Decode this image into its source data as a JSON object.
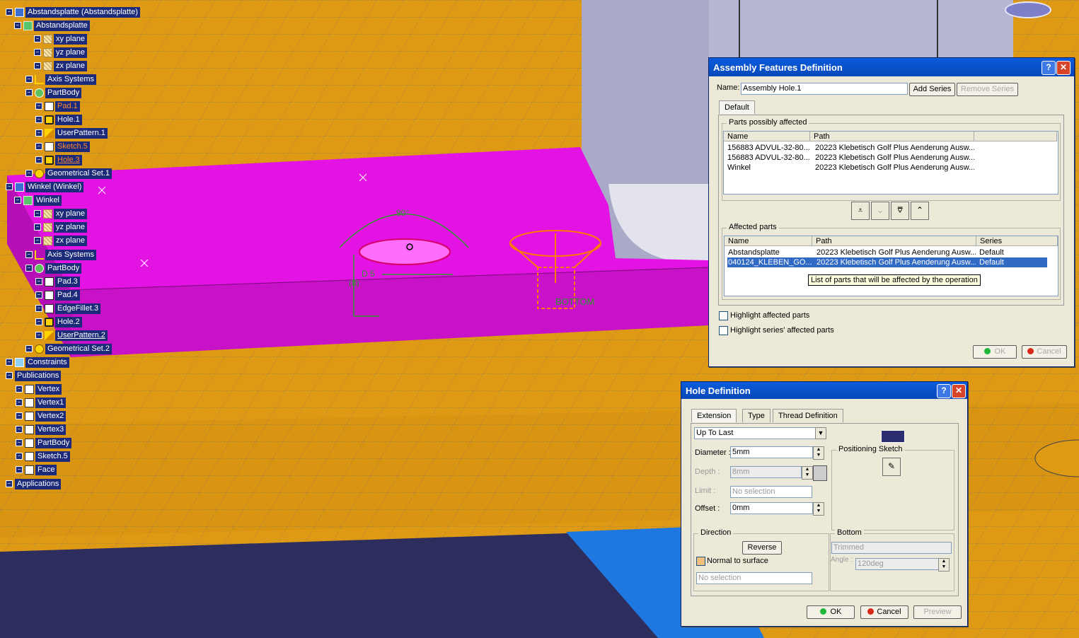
{
  "tree": {
    "items": [
      {
        "label": "Abstandsplatte (Abstandsplatte)",
        "icon": "product-icon",
        "x": 8,
        "y": 9,
        "style": ""
      },
      {
        "label": "Abstandsplatte",
        "icon": "part-icon",
        "x": 20,
        "y": 28,
        "style": ""
      },
      {
        "label": "xy plane",
        "icon": "plane-icon",
        "x": 48,
        "y": 47,
        "style": ""
      },
      {
        "label": "yz plane",
        "icon": "plane-icon",
        "x": 48,
        "y": 66,
        "style": ""
      },
      {
        "label": "zx plane",
        "icon": "plane-icon",
        "x": 48,
        "y": 85,
        "style": ""
      },
      {
        "label": "Axis Systems",
        "icon": "axis-icon",
        "x": 36,
        "y": 104,
        "style": ""
      },
      {
        "label": "PartBody",
        "icon": "body-icon",
        "x": 36,
        "y": 123,
        "style": ""
      },
      {
        "label": "Pad.1",
        "icon": "pad-icon",
        "x": 50,
        "y": 142,
        "style": "orange"
      },
      {
        "label": "Hole.1",
        "icon": "hole-icon",
        "x": 50,
        "y": 161,
        "style": ""
      },
      {
        "label": "UserPattern.1",
        "icon": "pattern-icon",
        "x": 50,
        "y": 180,
        "style": ""
      },
      {
        "label": "Sketch.5",
        "icon": "sketch-icon",
        "x": 50,
        "y": 199,
        "style": "orange"
      },
      {
        "label": "Hole.3",
        "icon": "hole-icon",
        "x": 50,
        "y": 218,
        "style": "hl"
      },
      {
        "label": "Geometrical Set.1",
        "icon": "geoset-icon",
        "x": 36,
        "y": 237,
        "style": ""
      },
      {
        "label": "Winkel (Winkel)",
        "icon": "product-icon",
        "x": 8,
        "y": 256,
        "style": ""
      },
      {
        "label": "Winkel",
        "icon": "part-icon",
        "x": 20,
        "y": 275,
        "style": ""
      },
      {
        "label": "xy plane",
        "icon": "plane-icon",
        "x": 48,
        "y": 294,
        "style": ""
      },
      {
        "label": "yz plane",
        "icon": "plane-icon",
        "x": 48,
        "y": 313,
        "style": ""
      },
      {
        "label": "zx plane",
        "icon": "plane-icon",
        "x": 48,
        "y": 332,
        "style": ""
      },
      {
        "label": "Axis Systems",
        "icon": "axis-icon",
        "x": 36,
        "y": 352,
        "style": ""
      },
      {
        "label": "PartBody",
        "icon": "body-icon",
        "x": 36,
        "y": 371,
        "style": ""
      },
      {
        "label": "Pad.3",
        "icon": "pad-icon",
        "x": 50,
        "y": 390,
        "style": ""
      },
      {
        "label": "Pad.4",
        "icon": "pad-icon",
        "x": 50,
        "y": 409,
        "style": ""
      },
      {
        "label": "EdgeFillet.3",
        "icon": "fillet-icon",
        "x": 50,
        "y": 428,
        "style": ""
      },
      {
        "label": "Hole.2",
        "icon": "hole-icon",
        "x": 50,
        "y": 447,
        "style": ""
      },
      {
        "label": "UserPattern.2",
        "icon": "pattern-icon",
        "x": 50,
        "y": 466,
        "style": "under"
      },
      {
        "label": "Geometrical Set.2",
        "icon": "geoset-icon",
        "x": 36,
        "y": 485,
        "style": ""
      },
      {
        "label": "Constraints",
        "icon": "constraints-icon",
        "x": 8,
        "y": 504,
        "style": ""
      },
      {
        "label": "Publications",
        "icon": "",
        "x": 8,
        "y": 523,
        "style": ""
      },
      {
        "label": "Vertex",
        "icon": "publication-icon",
        "x": 22,
        "y": 542,
        "style": ""
      },
      {
        "label": "Vertex1",
        "icon": "publication-icon",
        "x": 22,
        "y": 561,
        "style": ""
      },
      {
        "label": "Vertex2",
        "icon": "publication-icon",
        "x": 22,
        "y": 580,
        "style": ""
      },
      {
        "label": "Vertex3",
        "icon": "publication-icon",
        "x": 22,
        "y": 599,
        "style": ""
      },
      {
        "label": "PartBody",
        "icon": "publication-icon",
        "x": 22,
        "y": 618,
        "style": ""
      },
      {
        "label": "Sketch.5",
        "icon": "publication-icon",
        "x": 22,
        "y": 637,
        "style": ""
      },
      {
        "label": "Face",
        "icon": "publication-icon",
        "x": 22,
        "y": 656,
        "style": ""
      },
      {
        "label": "Applications",
        "icon": "",
        "x": 8,
        "y": 676,
        "style": ""
      }
    ]
  },
  "viewport": {
    "annot_angle": "90°",
    "annot_diameter": "D  5",
    "annot_depth": "(8)",
    "annot_bottom": "BOTTOM"
  },
  "assembly_dialog": {
    "title": "Assembly Features Definition",
    "name_label": "Name:",
    "name_value": "Assembly Hole.1",
    "add_series": "Add Series",
    "remove_series": "Remove Series",
    "tab_default": "Default",
    "possibly_group": "Parts possibly affected",
    "col_name": "Name",
    "col_path": "Path",
    "col_series": "Series",
    "possibly_rows": [
      {
        "name": "156883 ADVUL-32-80...",
        "path": "20223 Klebetisch Golf Plus Aenderung Ausw..."
      },
      {
        "name": "156883 ADVUL-32-80...",
        "path": "20223 Klebetisch Golf Plus Aenderung Ausw..."
      },
      {
        "name": "Winkel",
        "path": "20223 Klebetisch Golf Plus Aenderung Ausw..."
      }
    ],
    "affected_group": "Affected parts",
    "affected_rows": [
      {
        "name": "Abstandsplatte",
        "path": "20223 Klebetisch Golf Plus Aenderung Ausw...",
        "series": "Default"
      },
      {
        "name": "040124_KLEBEN_GO...",
        "path": "20223 Klebetisch Golf Plus Aenderung Ausw...",
        "series": "Default"
      }
    ],
    "tooltip": "List of parts that will be affected by the operation",
    "highlight_affected": "Highlight affected parts",
    "highlight_series": "Highlight series' affected parts",
    "ok": "OK",
    "cancel": "Cancel"
  },
  "hole_dialog": {
    "title": "Hole Definition",
    "tab_extension": "Extension",
    "tab_type": "Type",
    "tab_thread": "Thread Definition",
    "extension_value": "Up To Last",
    "diameter_label": "Diameter :",
    "diameter_value": "5mm",
    "depth_label": "Depth :",
    "depth_value": "8mm",
    "limit_label": "Limit :",
    "limit_value": "No selection",
    "offset_label": "Offset :",
    "offset_value": "0mm",
    "positioning_label": "Positioning Sketch",
    "direction_group": "Direction",
    "reverse": "Reverse",
    "normal_to_surface": "Normal to surface",
    "direction_selection": "No selection",
    "bottom_group": "Bottom",
    "bottom_value": "Trimmed",
    "angle_label": "Angle :",
    "angle_value": "120deg",
    "ok": "OK",
    "cancel": "Cancel",
    "preview": "Preview"
  },
  "colors": {
    "background": "#de9a14",
    "magenta": "#e313e3",
    "tree_label_bg": "#1c2a7a",
    "titlebar": "#0a5bdc",
    "selection": "#316ac5"
  }
}
